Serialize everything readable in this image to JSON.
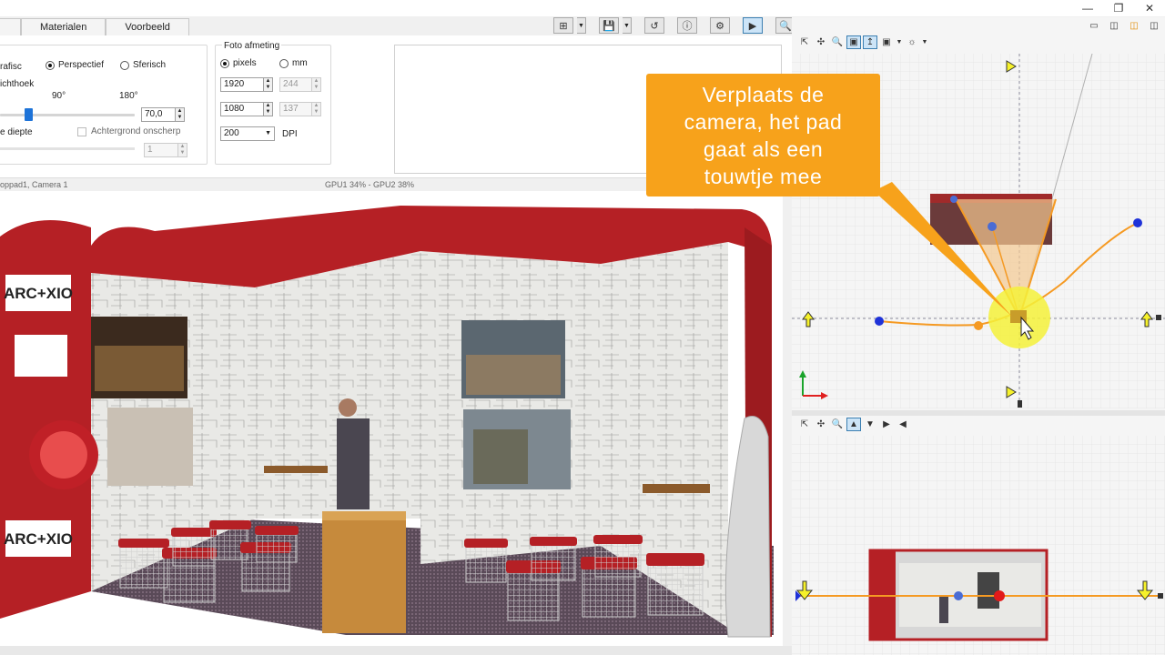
{
  "window": {
    "minimize_icon": "minimize",
    "restore_icon": "restore",
    "close_icon": "close"
  },
  "tabs": [
    "",
    "Materialen",
    "Voorbeeld"
  ],
  "toolbar": {
    "icons": [
      "export-icon",
      "save-icon",
      "camera-path-icon",
      "info-icon",
      "settings-icon",
      "render-view-icon",
      "zoom-icon"
    ]
  },
  "camera": {
    "projection_orthographic": "rafisc",
    "projection_perspective": "Perspectief",
    "projection_spherical": "Sferisch",
    "fov_label": "ichthoek",
    "fov_tick_90": "90°",
    "fov_tick_180": "180°",
    "fov_value": "70,0",
    "fov_fraction": 0.39,
    "depth_label": "e diepte",
    "blur_bg_label": "Achtergrond onscherp",
    "blur_value": "1"
  },
  "photo": {
    "title": "Foto afmeting",
    "unit_pixels": "pixels",
    "unit_mm": "mm",
    "width_px": "1920",
    "width_mm": "244",
    "height_px": "1080",
    "height_mm": "137",
    "dpi_value": "200",
    "dpi_label": "DPI"
  },
  "status": {
    "left": "oppad1, Camera 1",
    "gpu": "GPU1 34% - GPU2 38%"
  },
  "scene": {
    "logo_text": "ARC+XIO"
  },
  "callout": {
    "line1": "Verplaats de",
    "line2": "camera, het pad",
    "line3": "gaat als een",
    "line4": "touwtje mee"
  },
  "colors": {
    "accent": "#f7a21b",
    "booth_red": "#b52025",
    "path_orange": "#f59a23",
    "node_blue": "#1f32d8",
    "highlight": "#f4f13a"
  }
}
